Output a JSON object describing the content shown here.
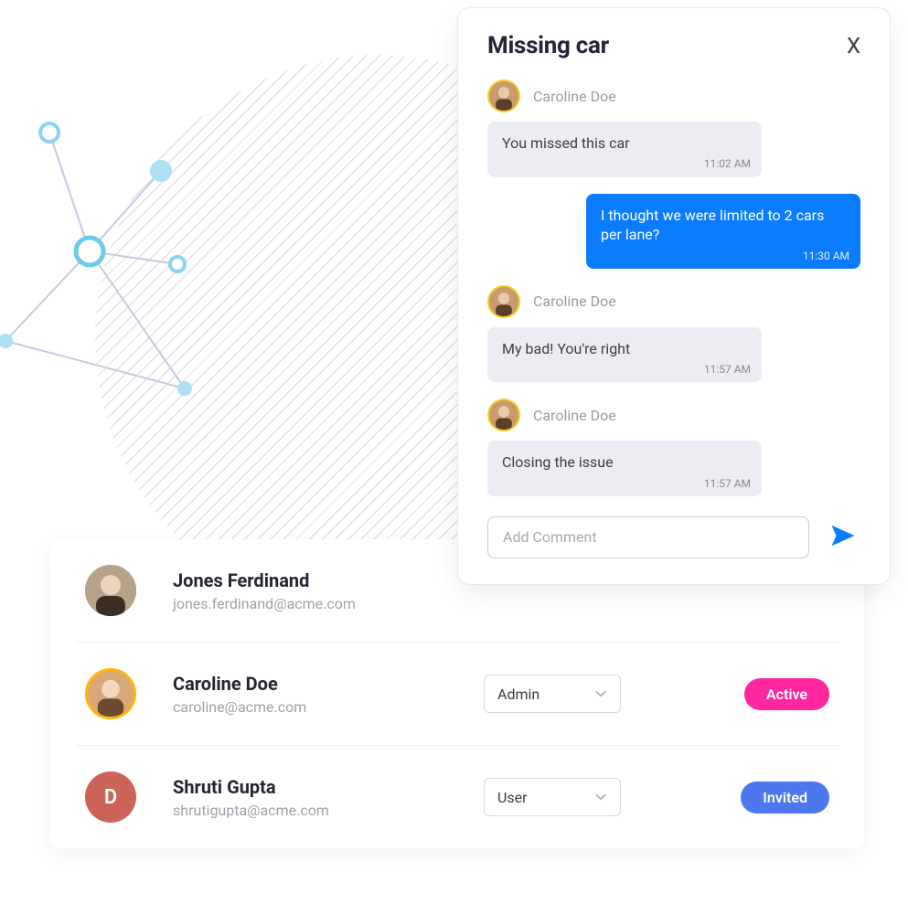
{
  "chat": {
    "title": "Missing car",
    "close_label": "X",
    "messages": [
      {
        "author": "Caroline Doe",
        "text": "You missed this car",
        "time": "11:02 AM",
        "side": "left"
      },
      {
        "author": "me",
        "text": "I thought we were limited to 2 cars per lane?",
        "time": "11:30 AM",
        "side": "right"
      },
      {
        "author": "Caroline Doe",
        "text": "My bad! You're right",
        "time": "11:57 AM",
        "side": "left"
      },
      {
        "author": "Caroline Doe",
        "text": "Closing the issue",
        "time": "11:57 AM",
        "side": "left"
      }
    ],
    "comment_placeholder": "Add Comment"
  },
  "users": [
    {
      "name": "Jones Ferdinand",
      "email": "jones.ferdinand@acme.com",
      "role": "",
      "status": "",
      "initial": ""
    },
    {
      "name": "Caroline Doe",
      "email": "caroline@acme.com",
      "role": "Admin",
      "status": "Active",
      "initial": ""
    },
    {
      "name": "Shruti Gupta",
      "email": "shrutigupta@acme.com",
      "role": "User",
      "status": "Invited",
      "initial": "D"
    }
  ]
}
